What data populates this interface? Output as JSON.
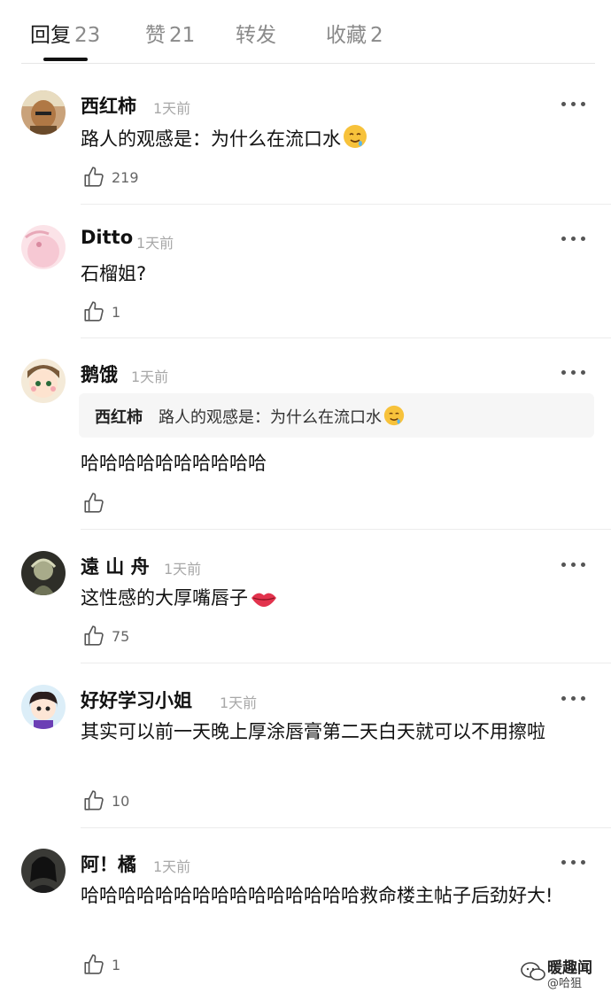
{
  "tabs": [
    {
      "label": "回复",
      "count": "23"
    },
    {
      "label": "赞",
      "count": "21"
    },
    {
      "label": "转发",
      "count": ""
    },
    {
      "label": "收藏",
      "count": "2"
    }
  ],
  "comments": [
    {
      "name": "西红柿",
      "time": "1天前",
      "text": "路人的观感是：为什么在流口水",
      "likes": "219"
    },
    {
      "name": "Ditto",
      "time": "1天前",
      "text": "石榴姐?",
      "likes": "1"
    },
    {
      "name": "鹅饿",
      "time": "1天前",
      "quote_name": "西红柿",
      "quote_text": "路人的观感是：为什么在流口水",
      "text": "哈哈哈哈哈哈哈哈哈哈",
      "likes": ""
    },
    {
      "name": "遠 山 舟",
      "time": "1天前",
      "text": "这性感的大厚嘴唇子",
      "likes": "75"
    },
    {
      "name": "好好学习小姐",
      "time": "1天前",
      "text": "其实可以前一天晚上厚涂唇膏第二天白天就可以不用擦啦",
      "likes": "10"
    },
    {
      "name": "阿！橘",
      "time": "1天前",
      "text": "哈哈哈哈哈哈哈哈哈哈哈哈哈哈哈救命楼主帖子后劲好大!",
      "likes": "1"
    }
  ],
  "watermark": {
    "title": "暖趣闻",
    "handle": "@哈狙"
  },
  "colors": {
    "text": "#111111",
    "muted": "#a8a8a8",
    "quote_bg": "#f6f6f6",
    "divider": "#ececec"
  }
}
